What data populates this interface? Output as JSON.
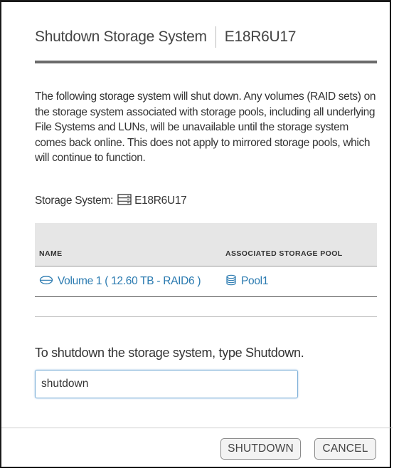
{
  "dialog": {
    "title": "Shutdown Storage System",
    "subtitle": "E18R6U17",
    "description": "The following storage system will shut down. Any volumes (RAID sets) on the storage system associated with storage pools, including all underlying File Systems and LUNs, will be unavailable until the storage system comes back online. This does not apply to mirrored storage pools, which will continue to function.",
    "storage_system_label": "Storage System:",
    "storage_system_icon": "server-icon",
    "storage_system_name": "E18R6U17"
  },
  "table": {
    "columns": [
      "NAME",
      "ASSOCIATED STORAGE POOL"
    ],
    "rows": [
      {
        "name": "Volume 1 ( 12.60 TB - RAID6 )",
        "name_icon": "volume-icon",
        "pool": "Pool1",
        "pool_icon": "pool-icon"
      }
    ]
  },
  "confirm": {
    "prompt": "To shutdown the storage system, type Shutdown.",
    "input_value": "shutdown"
  },
  "buttons": {
    "shutdown_label": "SHUTDOWN",
    "cancel_label": "CANCEL"
  },
  "colors": {
    "link": "#2a7ab0",
    "header_rule": "#6b6b6b",
    "table_header_bg": "#e6e6e6",
    "input_border": "#7fb1d8"
  }
}
